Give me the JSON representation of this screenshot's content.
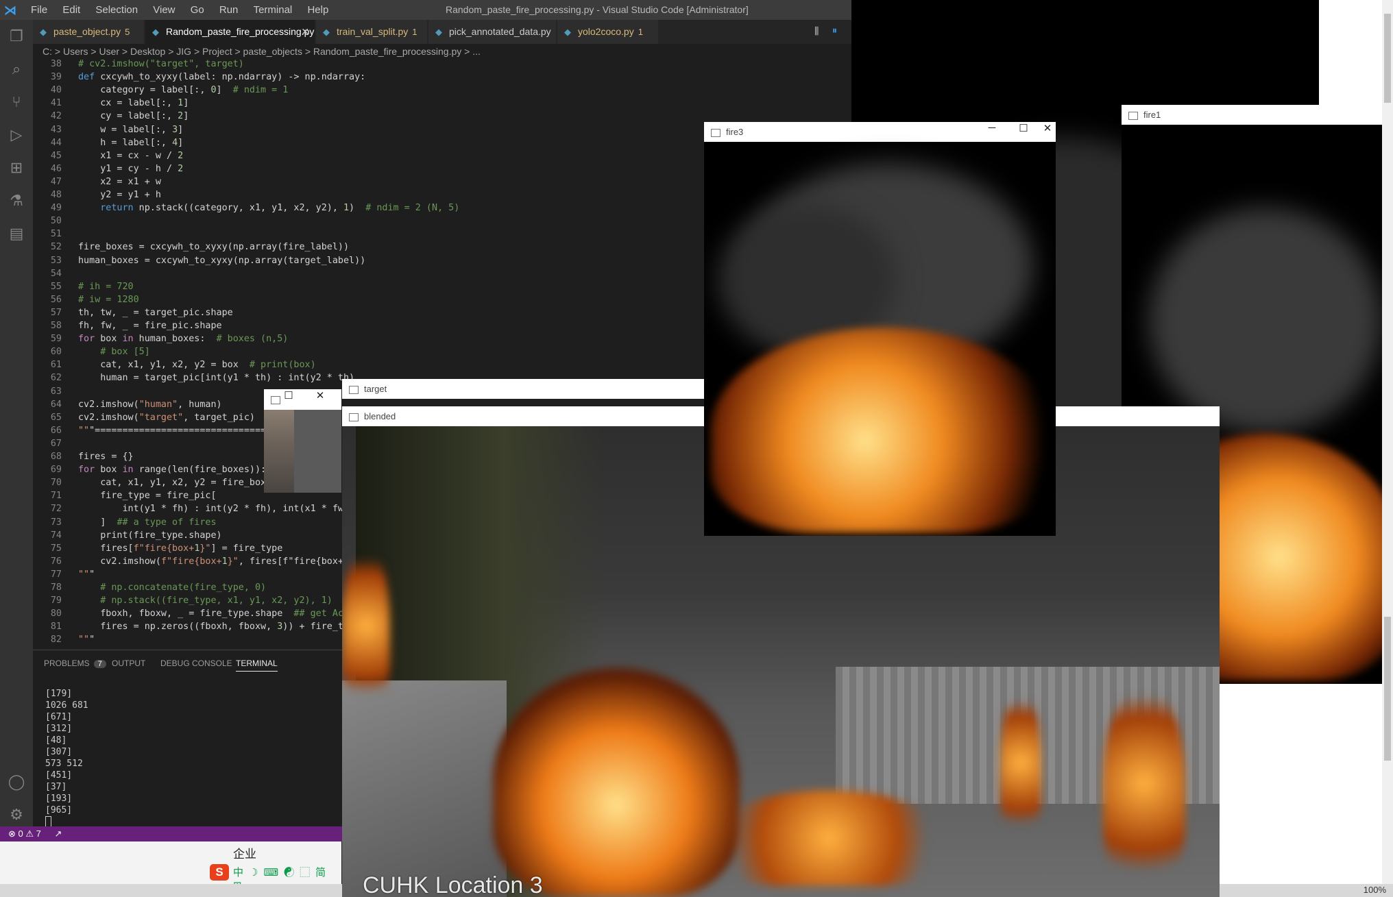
{
  "vscode": {
    "menu": [
      "File",
      "Edit",
      "Selection",
      "View",
      "Go",
      "Run",
      "Terminal",
      "Help"
    ],
    "window_title": "Random_paste_fire_processing.py - Visual Studio Code [Administrator]",
    "tabs": [
      {
        "label": "paste_object.py",
        "count": "5",
        "active": false
      },
      {
        "label": "Random_paste_fire_processing.py",
        "count": "",
        "active": true
      },
      {
        "label": "train_val_split.py",
        "count": "1",
        "active": false
      },
      {
        "label": "pick_annotated_data.py",
        "count": "",
        "active": false
      },
      {
        "label": "yolo2coco.py",
        "count": "1",
        "active": false
      }
    ],
    "breadcrumb": "C: > Users > User > Desktop > JIG > Project > paste_objects > Random_paste_fire_processing.py > ...",
    "line_numbers": [
      "38",
      "39",
      "40",
      "41",
      "42",
      "43",
      "44",
      "45",
      "46",
      "47",
      "48",
      "49",
      "50",
      "51",
      "52",
      "53",
      "54",
      "55",
      "56",
      "57",
      "58",
      "59",
      "60",
      "61",
      "62",
      "63",
      "64",
      "65",
      "66",
      "67",
      "68",
      "69",
      "70",
      "71",
      "72",
      "73",
      "74",
      "75",
      "76",
      "77",
      "78",
      "79",
      "80",
      "81",
      "82"
    ],
    "code_lines": [
      "# cv2.imshow(\"target\", target)",
      "def cxcywh_to_xyxy(label: np.ndarray) -> np.ndarray:",
      "    category = label[:, 0]  # ndim = 1",
      "    cx = label[:, 1]",
      "    cy = label[:, 2]",
      "    w = label[:, 3]",
      "    h = label[:, 4]",
      "    x1 = cx - w / 2",
      "    y1 = cy - h / 2",
      "    x2 = x1 + w",
      "    y2 = y1 + h",
      "    return np.stack((category, x1, y1, x2, y2), 1)  # ndim = 2 (N, 5)",
      "",
      "",
      "fire_boxes = cxcywh_to_xyxy(np.array(fire_label))",
      "human_boxes = cxcywh_to_xyxy(np.array(target_label))",
      "",
      "# ih = 720",
      "# iw = 1280",
      "th, tw, _ = target_pic.shape",
      "fh, fw, _ = fire_pic.shape",
      "for box in human_boxes:  # boxes (n,5)",
      "    # box [5]",
      "    cat, x1, y1, x2, y2 = box  # print(box)",
      "    human = target_pic[int(y1 * th) : int(y2 * th)",
      "",
      "cv2.imshow(\"human\", human)",
      "cv2.imshow(\"target\", target_pic)",
      "\"\"\"==================================",
      "",
      "fires = {}",
      "for box in range(len(fire_boxes)):",
      "    cat, x1, y1, x2, y2 = fire_boxe",
      "    fire_type = fire_pic[",
      "        int(y1 * fh) : int(y2 * fh), int(x1 * fw)",
      "    ]  ## a type of fires",
      "    print(fire_type.shape)",
      "    fires[f\"fire{box+1}\"] = fire_type",
      "    cv2.imshow(f\"fire{box+1}\", fires[f\"fire{box+1}",
      "\"\"\"",
      "    # np.concatenate(fire_type, 0)",
      "    # np.stack((fire_type, x1, y1, x2, y2), 1)",
      "    fboxh, fboxw, _ = fire_type.shape  ## get Actu",
      "    fires = np.zeros((fboxh, fboxw, 3)) + fire_typ",
      "\"\"\""
    ],
    "panel_tabs": {
      "problems": "PROBLEMS",
      "problems_count": "7",
      "output": "OUTPUT",
      "debug": "DEBUG CONSOLE",
      "terminal": "TERMINAL"
    },
    "terminal_lines": [
      "[179]",
      "1026 681",
      "[671]",
      "[312]",
      "[48]",
      "[307]",
      "573 512",
      "[451]",
      "[37]",
      "[193]",
      "[965]"
    ],
    "status": {
      "errors": "0",
      "warnings": "7"
    },
    "ime_label": "企业",
    "ime_icons": [
      "中",
      "☽",
      "⌨",
      "☯",
      "⬚",
      "简",
      "⊞"
    ]
  },
  "windows": {
    "fire3": {
      "title": "fire3"
    },
    "fire1": {
      "title": "fire1"
    },
    "target": {
      "title": "target"
    },
    "blended": {
      "title": "blended",
      "overlay_text": "CUHK Location 3"
    },
    "human": {
      "title": ""
    }
  },
  "taskbar": {
    "zoom": "100%"
  },
  "colors": {
    "statusbar": "#68217a",
    "titlebar": "#3c3c3c",
    "activitybar": "#333333",
    "editor_bg": "#1e1e1e"
  }
}
